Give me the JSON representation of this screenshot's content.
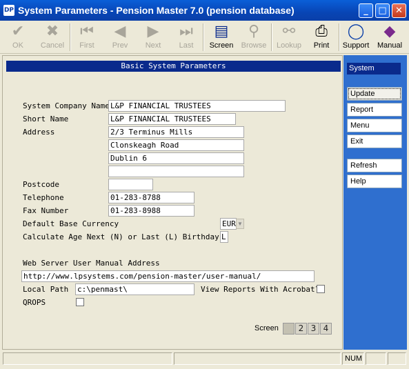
{
  "window": {
    "title": "System Parameters - Pension Master 7.0 (pension database)",
    "app_icon": "DP"
  },
  "toolbar": {
    "ok": "OK",
    "cancel": "Cancel",
    "first": "First",
    "prev": "Prev",
    "next": "Next",
    "last": "Last",
    "screen": "Screen",
    "browse": "Browse",
    "lookup": "Lookup",
    "print": "Print",
    "support": "Support",
    "manual": "Manual"
  },
  "form": {
    "header": "Basic System Parameters",
    "company_name_label": "System Company Name",
    "company_name": "L&P FINANCIAL TRUSTEES",
    "short_name_label": "Short Name",
    "short_name": "L&P FINANCIAL TRUSTEES",
    "address_label": "Address",
    "address": [
      "2/3 Terminus Mills",
      "Clonskeagh Road",
      "Dublin 6",
      ""
    ],
    "postcode_label": "Postcode",
    "postcode": "",
    "telephone_label": "Telephone",
    "telephone": "01-283-8788",
    "fax_label": "Fax Number",
    "fax": "01-283-8988",
    "currency_label": "Default Base Currency",
    "currency": "EUR",
    "age_label": "Calculate Age Next (N) or Last (L) Birthday",
    "age_value": "L",
    "web_manual_label": "Web Server User Manual Address",
    "web_manual_url": "http://www.lpsystems.com/pension-master/user-manual/",
    "local_path_label": "Local Path",
    "local_path": "c:\\penmast\\",
    "acrobat_label": "View Reports With Acrobat?",
    "qrops_label": "QROPS",
    "screen_label": "Screen",
    "screens": [
      "1",
      "2",
      "3",
      "4"
    ]
  },
  "sidebar": {
    "title": "System",
    "buttons": [
      "Update",
      "Report",
      "Menu",
      "Exit"
    ],
    "buttons2": [
      "Refresh",
      "Help"
    ]
  },
  "status": {
    "num": "NUM"
  }
}
